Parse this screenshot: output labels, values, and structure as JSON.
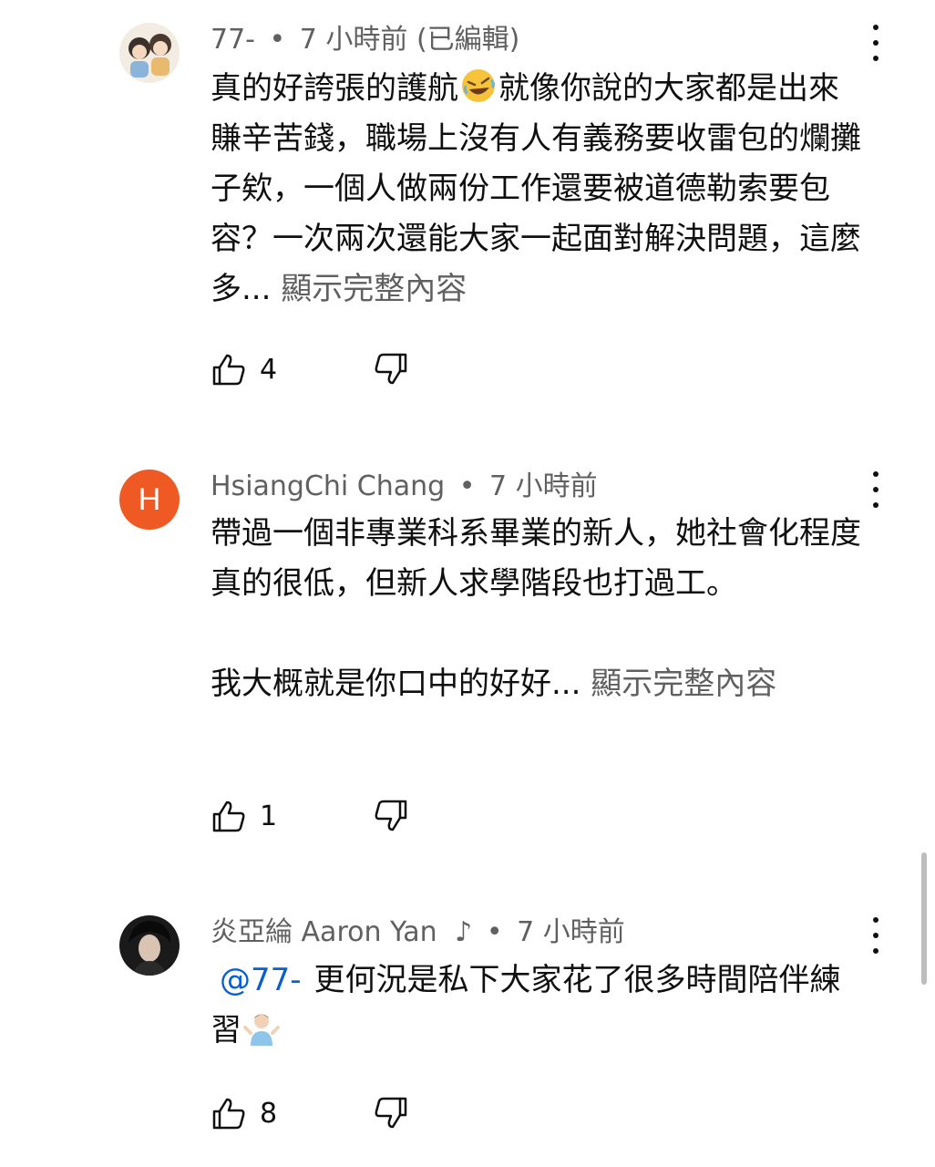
{
  "comments": [
    {
      "author": "77-",
      "separator": "•",
      "time": "7 小時前 (已編輯)",
      "body_before_emoji": "真的好誇張的護航",
      "emoji": "rolling-on-floor-laughing-emoji",
      "body_after_emoji": "就像你說的大家都是出來賺辛苦錢，職場上沒有人有義務要收雷包的爛攤子欸，一個人做兩份工作還要被道德勒索要包容？一次兩次還能大家一起面對解決問題，這麼多...",
      "show_more": "顯示完整內容",
      "likes": "4"
    },
    {
      "author": "HsiangChi Chang",
      "avatar_letter": "H",
      "avatar_color": "#ef5a24",
      "separator": "•",
      "time": "7 小時前",
      "body_paragraph_1": "帶過一個非專業科系畢業的新人，她社會化程度真的很低，但新人求學階段也打過工。",
      "body_paragraph_2": "我大概就是你口中的好好...",
      "show_more": "顯示完整內容",
      "likes": "1"
    },
    {
      "author": "炎亞綸 Aaron Yan",
      "author_badge": "music-note-icon",
      "separator": "•",
      "time": "7 小時前",
      "mention": "@77-",
      "body": "更何況是私下大家花了很多時間陪伴練習",
      "emoji": "person-shrugging-emoji",
      "likes": "8"
    }
  ],
  "colors": {
    "text": "#0f0f0f",
    "meta": "#606060",
    "link": "#065fd4"
  }
}
